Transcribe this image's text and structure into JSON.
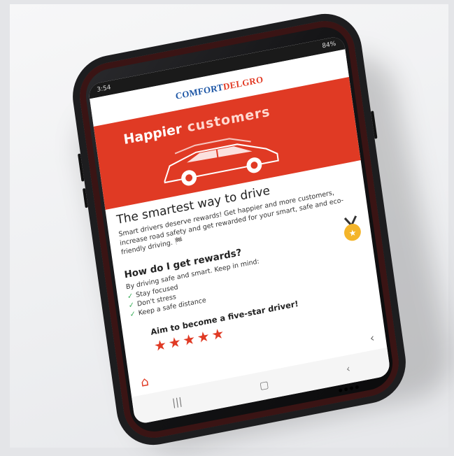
{
  "status_bar": {
    "time": "3:54",
    "battery": "84%"
  },
  "app": {
    "logo_part1": "COMFORT",
    "logo_part2": "DELGRO",
    "banner": {
      "title_part1": "Happier",
      "title_part2": "customers"
    },
    "main_heading": "The smartest way to drive",
    "main_paragraph": "Smart drivers deserve rewards! Get happier and more customers, increase road safety and get rewarded for your smart, safe and eco-friendly driving. 🏁",
    "rewards_heading": "How do I get rewards?",
    "rewards_intro": "By driving safe and smart. Keep in mind:",
    "tips": [
      "Stay focused",
      "Don't stress",
      "Keep a safe distance"
    ],
    "aim_text": "Aim to become a five-star driver!",
    "star_rating": 5
  },
  "icons": {
    "home": "home-icon",
    "back": "chevron-left-icon",
    "recents": "recent-apps-icon",
    "home_sys": "home-button-icon",
    "medal": "medal-icon",
    "star": "star-icon",
    "check": "check-icon"
  },
  "colors": {
    "brand_red": "#e03a24",
    "brand_blue": "#1b55a5",
    "check_green": "#2ea84f"
  }
}
